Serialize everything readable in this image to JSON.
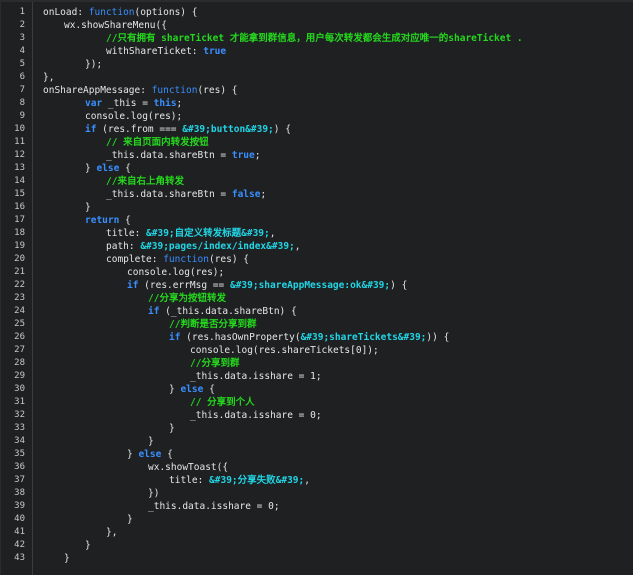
{
  "lines": [
    {
      "n": "1",
      "i": 0,
      "parts": [
        [
          "pl",
          "onLoad: "
        ],
        [
          "fn",
          "function"
        ],
        [
          "pl",
          "(options) {"
        ]
      ]
    },
    {
      "n": "2",
      "i": 1,
      "parts": [
        [
          "pl",
          "wx.showShareMenu({"
        ]
      ]
    },
    {
      "n": "3",
      "i": 3,
      "parts": [
        [
          "cm",
          "//只有拥有 shareTicket 才能拿到群信息，用户每次转发都会生成对应唯一的shareTicket ."
        ]
      ]
    },
    {
      "n": "4",
      "i": 3,
      "parts": [
        [
          "pl",
          "withShareTicket: "
        ],
        [
          "bool",
          "true"
        ]
      ]
    },
    {
      "n": "5",
      "i": 2,
      "parts": [
        [
          "pl",
          "});"
        ]
      ]
    },
    {
      "n": "6",
      "i": 0,
      "parts": [
        [
          "pl",
          "},"
        ]
      ]
    },
    {
      "n": "7",
      "i": 0,
      "parts": [
        [
          "pl",
          "onShareAppMessage: "
        ],
        [
          "fn",
          "function"
        ],
        [
          "pl",
          "(res) {"
        ]
      ]
    },
    {
      "n": "8",
      "i": 2,
      "parts": [
        [
          "kw",
          "var"
        ],
        [
          "pl",
          " _this = "
        ],
        [
          "kw",
          "this"
        ],
        [
          "pl",
          ";"
        ]
      ]
    },
    {
      "n": "9",
      "i": 2,
      "parts": [
        [
          "pl",
          "console.log(res);"
        ]
      ]
    },
    {
      "n": "10",
      "i": 2,
      "parts": [
        [
          "kw",
          "if"
        ],
        [
          "pl",
          " (res.from === "
        ],
        [
          "st",
          "&#39;button&#39;"
        ],
        [
          "pl",
          ") {"
        ]
      ]
    },
    {
      "n": "11",
      "i": 3,
      "parts": [
        [
          "cm",
          "// 来自页面内转发按钮"
        ]
      ]
    },
    {
      "n": "12",
      "i": 3,
      "parts": [
        [
          "pl",
          "_this.data.shareBtn = "
        ],
        [
          "bool",
          "true"
        ],
        [
          "pl",
          ";"
        ]
      ]
    },
    {
      "n": "13",
      "i": 2,
      "parts": [
        [
          "pl",
          "} "
        ],
        [
          "kw",
          "else"
        ],
        [
          "pl",
          " {"
        ]
      ]
    },
    {
      "n": "14",
      "i": 3,
      "parts": [
        [
          "cm",
          "//来自右上角转发"
        ]
      ]
    },
    {
      "n": "15",
      "i": 3,
      "parts": [
        [
          "pl",
          "_this.data.shareBtn = "
        ],
        [
          "bool",
          "false"
        ],
        [
          "pl",
          ";"
        ]
      ]
    },
    {
      "n": "16",
      "i": 2,
      "parts": [
        [
          "pl",
          "}"
        ]
      ]
    },
    {
      "n": "17",
      "i": 2,
      "parts": [
        [
          "kw",
          "return"
        ],
        [
          "pl",
          " {"
        ]
      ]
    },
    {
      "n": "18",
      "i": 3,
      "parts": [
        [
          "pl",
          "title: "
        ],
        [
          "st",
          "&#39;自定义转发标题&#39;"
        ],
        [
          "pl",
          ","
        ]
      ]
    },
    {
      "n": "19",
      "i": 3,
      "parts": [
        [
          "pl",
          "path: "
        ],
        [
          "st",
          "&#39;pages/index/index&#39;"
        ],
        [
          "pl",
          ","
        ]
      ]
    },
    {
      "n": "20",
      "i": 3,
      "parts": [
        [
          "pl",
          "complete: "
        ],
        [
          "fn",
          "function"
        ],
        [
          "pl",
          "(res) {"
        ]
      ]
    },
    {
      "n": "21",
      "i": 4,
      "parts": [
        [
          "pl",
          "console.log(res);"
        ]
      ]
    },
    {
      "n": "22",
      "i": 4,
      "parts": [
        [
          "kw",
          "if"
        ],
        [
          "pl",
          " (res.errMsg == "
        ],
        [
          "st",
          "&#39;shareAppMessage:ok&#39;"
        ],
        [
          "pl",
          ") {"
        ]
      ]
    },
    {
      "n": "23",
      "i": 5,
      "parts": [
        [
          "cm",
          "//分享为按钮转发"
        ]
      ]
    },
    {
      "n": "24",
      "i": 5,
      "parts": [
        [
          "kw",
          "if"
        ],
        [
          "pl",
          " (_this.data.shareBtn) {"
        ]
      ]
    },
    {
      "n": "25",
      "i": 6,
      "parts": [
        [
          "cm",
          "//判断是否分享到群"
        ]
      ]
    },
    {
      "n": "26",
      "i": 6,
      "parts": [
        [
          "kw",
          "if"
        ],
        [
          "pl",
          " (res.hasOwnProperty("
        ],
        [
          "st",
          "&#39;shareTickets&#39;"
        ],
        [
          "pl",
          ")) {"
        ]
      ]
    },
    {
      "n": "27",
      "i": 7,
      "parts": [
        [
          "pl",
          "console.log(res.shareTickets[0]);"
        ]
      ]
    },
    {
      "n": "28",
      "i": 7,
      "parts": [
        [
          "cm",
          "//分享到群"
        ]
      ]
    },
    {
      "n": "29",
      "i": 7,
      "parts": [
        [
          "pl",
          "_this.data.isshare = 1;"
        ]
      ]
    },
    {
      "n": "30",
      "i": 6,
      "parts": [
        [
          "pl",
          "} "
        ],
        [
          "kw",
          "else"
        ],
        [
          "pl",
          " {"
        ]
      ]
    },
    {
      "n": "31",
      "i": 7,
      "parts": [
        [
          "cm",
          "// 分享到个人"
        ]
      ]
    },
    {
      "n": "32",
      "i": 7,
      "parts": [
        [
          "pl",
          "_this.data.isshare = 0;"
        ]
      ]
    },
    {
      "n": "33",
      "i": 6,
      "parts": [
        [
          "pl",
          "}"
        ]
      ]
    },
    {
      "n": "34",
      "i": 5,
      "parts": [
        [
          "pl",
          "}"
        ]
      ]
    },
    {
      "n": "35",
      "i": 4,
      "parts": [
        [
          "pl",
          "} "
        ],
        [
          "kw",
          "else"
        ],
        [
          "pl",
          " {"
        ]
      ]
    },
    {
      "n": "36",
      "i": 5,
      "parts": [
        [
          "pl",
          "wx.showToast({"
        ]
      ]
    },
    {
      "n": "37",
      "i": 6,
      "parts": [
        [
          "pl",
          "title: "
        ],
        [
          "st",
          "&#39;分享失败&#39;"
        ],
        [
          "pl",
          ","
        ]
      ]
    },
    {
      "n": "38",
      "i": 5,
      "parts": [
        [
          "pl",
          "})"
        ]
      ]
    },
    {
      "n": "39",
      "i": 5,
      "parts": [
        [
          "pl",
          "_this.data.isshare = 0;"
        ]
      ]
    },
    {
      "n": "40",
      "i": 4,
      "parts": [
        [
          "pl",
          "}"
        ]
      ]
    },
    {
      "n": "41",
      "i": 3,
      "parts": [
        [
          "pl",
          "},"
        ]
      ]
    },
    {
      "n": "42",
      "i": 2,
      "parts": [
        [
          "pl",
          "}"
        ]
      ]
    },
    {
      "n": "43",
      "i": 1,
      "parts": [
        [
          "pl",
          "}"
        ]
      ]
    }
  ]
}
